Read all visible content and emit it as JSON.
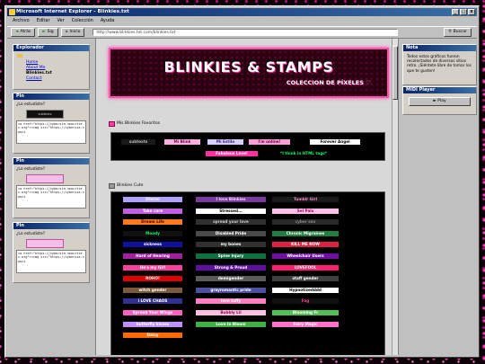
{
  "window": {
    "title": "Microsoft Internet Explorer - Blinkies.txt",
    "controls": [
      "_",
      "□",
      "x"
    ]
  },
  "menu": [
    "Archivo",
    "Editar",
    "Ver",
    "Colección",
    "Ayuda"
  ],
  "toolbar": {
    "back": "Atrás",
    "forward": "Sig",
    "home": "Inicio",
    "search": "Buscar",
    "address": "http://www.blinkies.txt.com/blinkies.txt"
  },
  "sidebar": {
    "explorer_title": "Explorador",
    "tree": [
      "Home",
      "About Me",
      "Blinkies.txt",
      "Contact"
    ],
    "pins": [
      {
        "title": "Pin",
        "label": "¿Lo estudiste?",
        "img": "subtexts",
        "code": "<a href=\"https://cybersia.neocities.org\"><img src=\"https://cybersia.neoci"
      },
      {
        "title": "Pin",
        "label": "¿Lo estudiste?",
        "img": "pink-blinkie",
        "code": "<a href=\"https://cybersia.neocities.org\"><img src=\"https://cybersia.neoci"
      },
      {
        "title": "Pin",
        "label": "¿Lo estudiste?",
        "img": "pink-blinkie",
        "code": "<a href=\"https://cybersia.neocities.org\"><img src=\"https://cybersia.neoci"
      }
    ]
  },
  "banner": {
    "title": "BLINKIES & STAMPS",
    "subtitle": "COLECCION DE PÍXELES",
    "heart": "♡"
  },
  "sections": {
    "favorites": "Mis Blinkies Favoritos",
    "cute": "Blinkies Cute"
  },
  "favorites": [
    {
      "text": "subtexts",
      "bg": "#1a1a1a",
      "fg": "#bbbbbb"
    },
    {
      "text": "Mi Blink",
      "bg": "#ffb0e0",
      "fg": "#7a0050"
    },
    {
      "text": "Mi Estilo",
      "bg": "#d8d0ff",
      "fg": "#3a2080"
    },
    {
      "text": "I'm online!",
      "bg": "#ff9ed8",
      "fg": "#600040"
    },
    {
      "text": "Forever Angel",
      "bg": "#ffffff",
      "fg": "#000000"
    },
    {
      "text": "Fabulous Love!",
      "bg": "#ff30a0",
      "fg": "#ffffff"
    },
    {
      "text": "*I think in HTML tags*",
      "bg": "#000000",
      "fg": "#00ff66"
    }
  ],
  "cute_blinkies": [
    {
      "text": "Stereo",
      "bg": "#b0a0ff",
      "fg": "#ffffff"
    },
    {
      "text": "I love Blinkies",
      "bg": "#7a3aa0",
      "fg": "#ffd0ff"
    },
    {
      "text": "Tumblr Girl",
      "bg": "#1a1a1a",
      "fg": "#ff88cc"
    },
    {
      "text": "Take care",
      "bg": "#c060e0",
      "fg": "#ffffff"
    },
    {
      "text": "Stressed...",
      "bg": "#ffffff",
      "fg": "#000000"
    },
    {
      "text": "Sel Pals",
      "bg": "#ffc0e8",
      "fg": "#a00060"
    },
    {
      "text": "Dream Life",
      "bg": "#ff7a20",
      "fg": "#400000"
    },
    {
      "text": "spread your love",
      "bg": "#303030",
      "fg": "#cccccc"
    },
    {
      "text": "cyber sex",
      "bg": "#2a2a2a",
      "fg": "#888888"
    },
    {
      "text": "Moody",
      "bg": "#101010",
      "fg": "#00ff66"
    },
    {
      "text": "Disabled Pride",
      "bg": "#4a4a4a",
      "fg": "#ffffff"
    },
    {
      "text": "Chronic Migraines",
      "bg": "#208040",
      "fg": "#ffffff"
    },
    {
      "text": "sickness",
      "bg": "#1010a0",
      "fg": "#ffffff"
    },
    {
      "text": "my bones",
      "bg": "#303030",
      "fg": "#ffffff"
    },
    {
      "text": "KILL ME NOW",
      "bg": "#e02040",
      "fg": "#ffffff"
    },
    {
      "text": "Hard of Hearing",
      "bg": "#a020a0",
      "fg": "#ffffff"
    },
    {
      "text": "Spine Injury",
      "bg": "#107040",
      "fg": "#ffffff"
    },
    {
      "text": "Wheelchair Users",
      "bg": "#7010a0",
      "fg": "#ffffff"
    },
    {
      "text": "He's my Girl",
      "bg": "#ff40a0",
      "fg": "#ffffff"
    },
    {
      "text": "Strong & Proud",
      "bg": "#6010a0",
      "fg": "#ffffff"
    },
    {
      "text": "LOVEFOOL",
      "bg": "#ff2070",
      "fg": "#ffffff"
    },
    {
      "text": "ROHO!",
      "bg": "#e00000",
      "fg": "#ffffff"
    },
    {
      "text": "demigender",
      "bg": "#5a5a5a",
      "fg": "#ffffff"
    },
    {
      "text": "staff gender",
      "bg": "#404040",
      "fg": "#ffffff"
    },
    {
      "text": "witch gender",
      "bg": "#7a5a3a",
      "fg": "#ffffff"
    },
    {
      "text": "grayromantic pride",
      "bg": "#5050a0",
      "fg": "#ffffff"
    },
    {
      "text": "Hypnotizedddd",
      "bg": "#ffffff",
      "fg": "#000000"
    },
    {
      "text": "i LOVE CHAOS",
      "bg": "#303090",
      "fg": "#ffffff"
    },
    {
      "text": "love taffy",
      "bg": "#ff80c0",
      "fg": "#ffffff"
    },
    {
      "text": "Fag",
      "bg": "#101010",
      "fg": "#ff4090"
    },
    {
      "text": "Spread Your Wings",
      "bg": "#ff60c0",
      "fg": "#ffffff"
    },
    {
      "text": "Bubbly Lil",
      "bg": "#ffc0e0",
      "fg": "#a00060"
    },
    {
      "text": "Blooming Fr",
      "bg": "#50c050",
      "fg": "#ffffff"
    },
    {
      "text": "butterfly kisses",
      "bg": "#c090ff",
      "fg": "#ffffff"
    },
    {
      "text": "Love In Bloom",
      "bg": "#40b040",
      "fg": "#ffffff"
    },
    {
      "text": "Fairy Magic",
      "bg": "#ff70c8",
      "fg": "#ffffff"
    },
    {
      "text": "Daisy",
      "bg": "#ff6a00",
      "fg": "#ffffff"
    }
  ],
  "right": {
    "nota_title": "Nota",
    "nota_text": "Todos estos gráficos fueron recolectados de diversos sitios retro. ¡Siéntete libre de tomar los que te gusten!",
    "midi_title": "MIDI Player",
    "play": "► Play"
  }
}
